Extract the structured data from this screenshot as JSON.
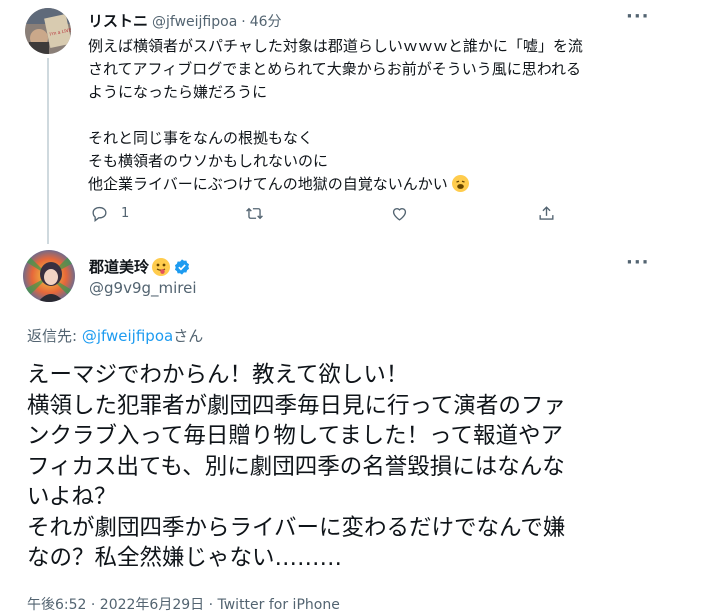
{
  "reply_tweet": {
    "display_name": "リストニ",
    "handle": "@jfweijfipoa",
    "separator": "·",
    "time_ago": "46分",
    "more": "···",
    "lines": [
      "例えば横領者がスパチャした対象は郡道らしいｗｗｗと誰かに「嘘」を流",
      "されてアフィブログでまとめられて大衆からお前がそういう風に思われる",
      "ようになったら嫌だろうに",
      "",
      "それと同じ事をなんの根拠もなく",
      "そも横領者のウソかもしれないのに",
      "他企業ライバーにぶつけてんの地獄の自覚ないんかい"
    ],
    "reply_count": "1",
    "icons": [
      "reply-icon",
      "retweet-icon",
      "like-icon",
      "share-icon"
    ],
    "avatar_text": "I'm a LIVER FOREVER"
  },
  "main_tweet": {
    "display_name": "郡道美玲",
    "handle": "@g9v9g_mirei",
    "more": "···",
    "replying_prefix": "返信先: ",
    "replying_handle": "@jfweijfipoa",
    "replying_suffix": "さん",
    "lines": [
      "えーマジでわからん！教えて欲しい！",
      "横領した犯罪者が劇団四季毎日見に行って演者のファ",
      "ンクラブ入って毎日贈り物してました！って報道やア",
      "フィカス出ても、別に劇団四季の名誉毀損にはなんな",
      "いよね？",
      "それが劇団四季からライバーに変わるだけでなんで嫌",
      "なの？私全然嫌じゃない………"
    ],
    "timestamp": "午後6:52 · 2022年6月29日 · Twitter for iPhone",
    "verified": true
  },
  "colors": {
    "link": "#1d9bf0",
    "muted": "#536471",
    "text": "#0f1419",
    "line": "#cfd9de"
  }
}
